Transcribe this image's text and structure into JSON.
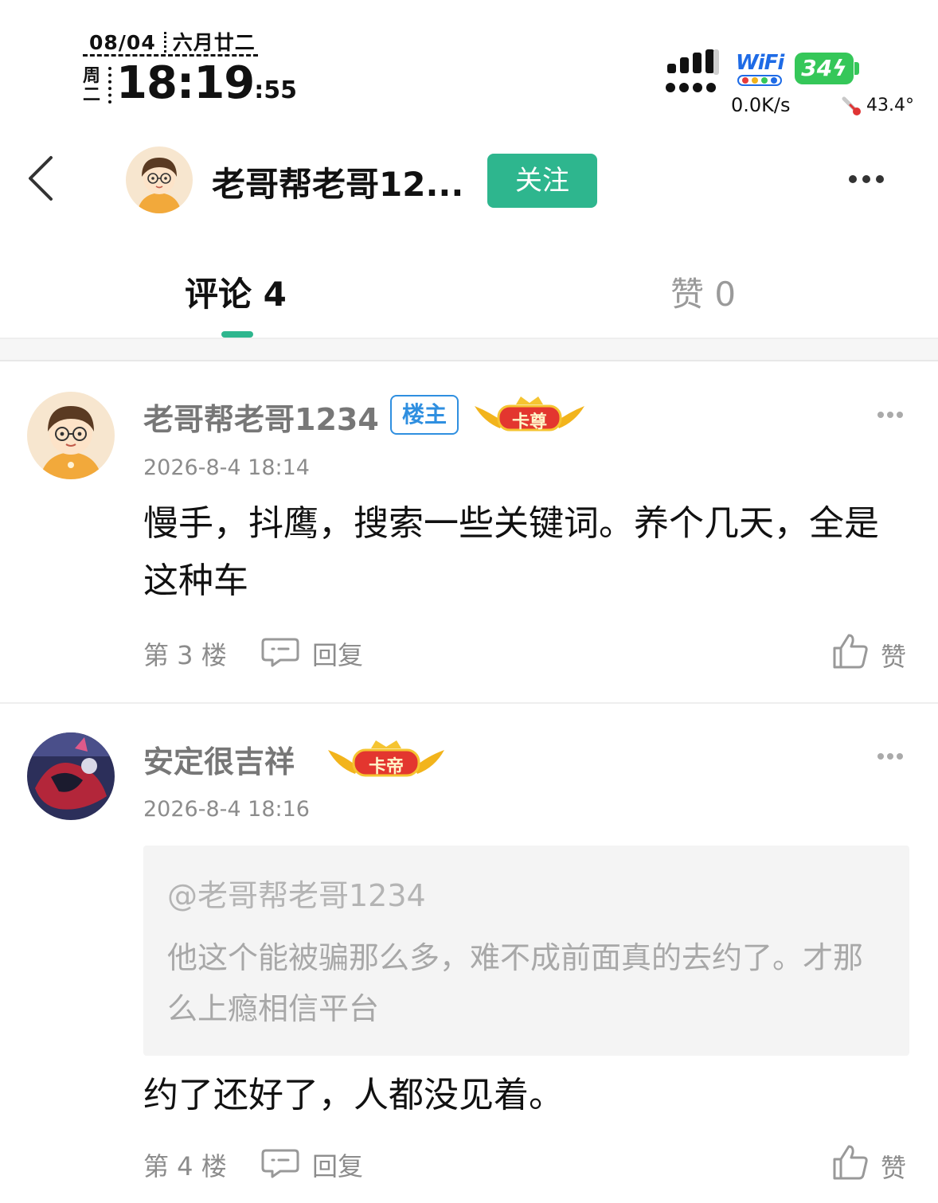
{
  "status_bar": {
    "date": "08/04",
    "lunar_date": "六月廿二",
    "weekday": "周二",
    "time": "18:19",
    "seconds": ":55",
    "wifi_label": "WiFi",
    "battery": "34",
    "net_speed": "0.0K/s",
    "temperature": "43.4°"
  },
  "header": {
    "title": "老哥帮老哥12...",
    "follow_label": "关注"
  },
  "tabs": {
    "comments_label": "评论 4",
    "likes_label": "赞 0"
  },
  "comments": [
    {
      "author": "老哥帮老哥1234",
      "op_badge": "楼主",
      "rank_badge": "卡尊",
      "time": "2026-8-4 18:14",
      "text": "慢手，抖鹰，搜索一些关键词。养个几天，全是这种车",
      "floor": "第 3 楼",
      "reply_label": "回复",
      "like_label": "赞"
    },
    {
      "author": "安定很吉祥",
      "rank_badge": "卡帝",
      "time": "2026-8-4 18:16",
      "quote_author": "@老哥帮老哥1234",
      "quote_text": "他这个能被骗那么多，难不成前面真的去约了。才那么上瘾相信平台",
      "text": "约了还好了，人都没见着。",
      "floor": "第 4 楼",
      "reply_label": "回复",
      "like_label": "赞"
    }
  ],
  "colors": {
    "accent": "#2eb68e",
    "op_badge": "#2f8fe0",
    "battery": "#35c759",
    "wifi": "#1e6be6"
  }
}
